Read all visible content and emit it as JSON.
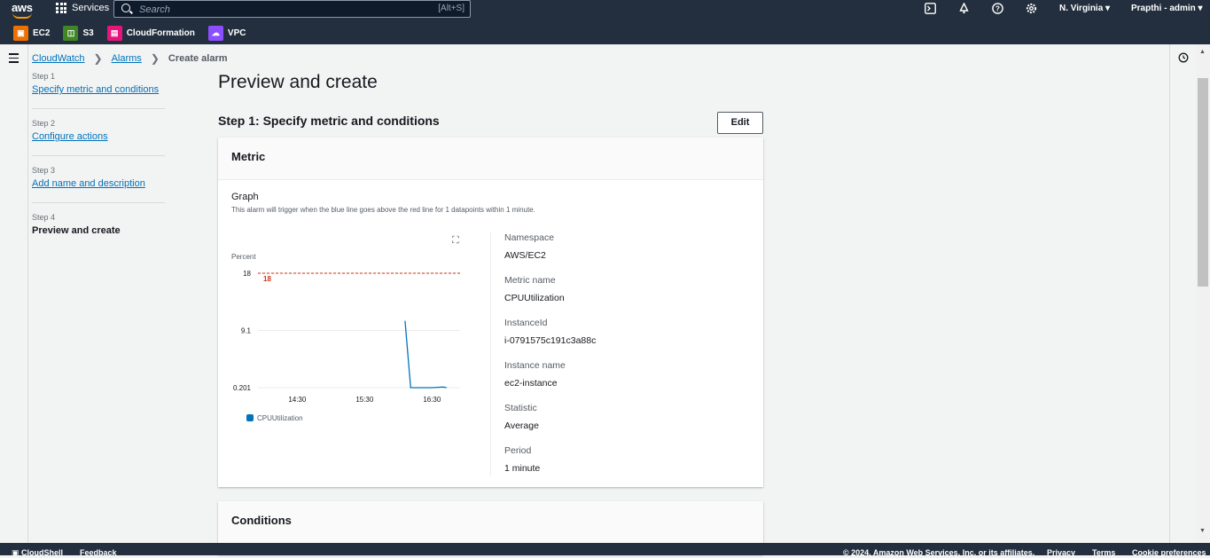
{
  "topnav": {
    "logo": "aws",
    "services_label": "Services",
    "search_placeholder": "Search",
    "search_shortcut": "[Alt+S]",
    "region": "N. Virginia ▾",
    "account": "Prapthi - admin ▾",
    "icons": [
      "cloudshell-icon",
      "bell-icon",
      "help-icon",
      "gear-icon"
    ]
  },
  "favorites": [
    {
      "label": "EC2",
      "color": "#ed7100"
    },
    {
      "label": "S3",
      "color": "#3f8624"
    },
    {
      "label": "CloudFormation",
      "color": "#e7157b"
    },
    {
      "label": "VPC",
      "color": "#8c4fff"
    }
  ],
  "breadcrumb": {
    "items": [
      "CloudWatch",
      "Alarms"
    ],
    "current": "Create alarm"
  },
  "wizard": {
    "steps": [
      {
        "num": "Step 1",
        "label": "Specify metric and conditions"
      },
      {
        "num": "Step 2",
        "label": "Configure actions"
      },
      {
        "num": "Step 3",
        "label": "Add name and description"
      },
      {
        "num": "Step 4",
        "label": "Preview and create"
      }
    ]
  },
  "main": {
    "page_title": "Preview and create",
    "step1_title": "Step 1: Specify metric and conditions",
    "edit_label": "Edit",
    "metric_header": "Metric",
    "graph_label": "Graph",
    "graph_desc": "This alarm will trigger when the blue line goes above the red line for 1 datapoints within 1 minute.",
    "details": [
      {
        "key": "Namespace",
        "value": "AWS/EC2"
      },
      {
        "key": "Metric name",
        "value": "CPUUtilization"
      },
      {
        "key": "InstanceId",
        "value": "i-0791575c191c3a88c"
      },
      {
        "key": "Instance name",
        "value": "ec2-instance"
      },
      {
        "key": "Statistic",
        "value": "Average"
      },
      {
        "key": "Period",
        "value": "1 minute"
      }
    ],
    "conditions_header": "Conditions"
  },
  "chart_data": {
    "type": "line",
    "ylabel": "Percent",
    "y_ticks": [
      "18",
      "9.1",
      "0.201"
    ],
    "ylim": [
      0.201,
      18
    ],
    "x_ticks": [
      "14:30",
      "15:30",
      "16:30"
    ],
    "threshold": {
      "value": 18,
      "label": "18",
      "color": "#d13212"
    },
    "series": [
      {
        "name": "CPUUtilization",
        "color": "#0073bb",
        "points": [
          [
            "16:06",
            10.6
          ],
          [
            "16:11",
            0.201
          ],
          [
            "16:30",
            0.201
          ],
          [
            "16:40",
            0.3
          ],
          [
            "16:43",
            0.201
          ]
        ]
      }
    ]
  },
  "footer": {
    "cloudshell": "CloudShell",
    "feedback": "Feedback",
    "copyright": "© 2024, Amazon Web Services, Inc. or its affiliates.",
    "privacy": "Privacy",
    "terms": "Terms",
    "cookies": "Cookie preferences"
  }
}
